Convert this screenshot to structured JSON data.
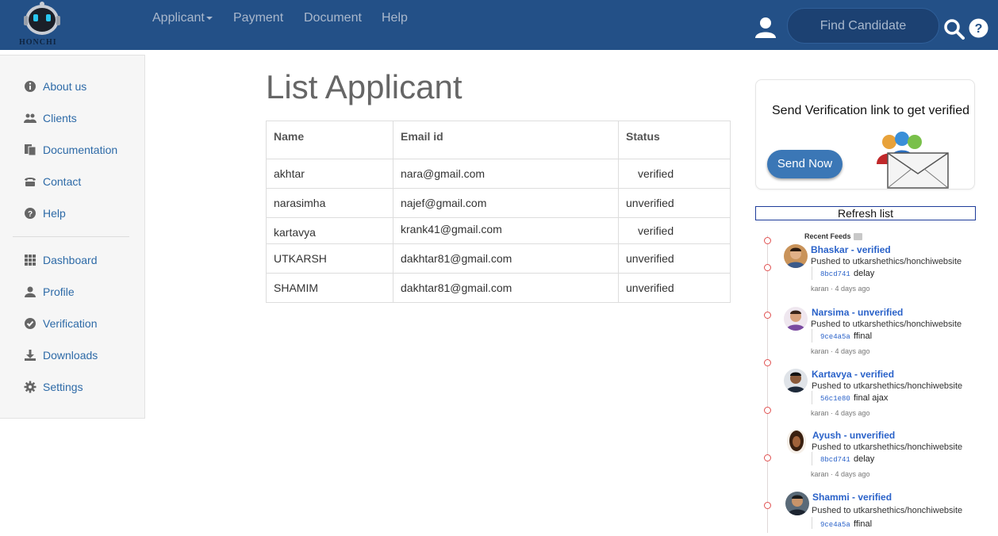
{
  "navbar": {
    "logo_text": "HONCHI",
    "menu": [
      {
        "label": "Applicant",
        "has_dropdown": true
      },
      {
        "label": "Payment"
      },
      {
        "label": "Document"
      },
      {
        "label": "Help"
      }
    ],
    "search_label": "Find Candidate",
    "colors": {
      "background": "#235087",
      "search_bg": "#1c4172"
    }
  },
  "sidebar": {
    "items": [
      {
        "label": "About us",
        "icon": "info-circle-icon"
      },
      {
        "label": "Clients",
        "icon": "users-icon"
      },
      {
        "label": "Documentation",
        "icon": "files-icon"
      },
      {
        "label": "Contact",
        "icon": "phone-icon"
      },
      {
        "label": "Help",
        "icon": "question-circle-icon"
      },
      {
        "label": "Dashboard",
        "icon": "grid-icon"
      },
      {
        "label": "Profile",
        "icon": "user-icon"
      },
      {
        "label": "Verification",
        "icon": "check-circle-icon"
      },
      {
        "label": "Downloads",
        "icon": "download-icon"
      },
      {
        "label": "Settings",
        "icon": "gear-icon"
      }
    ]
  },
  "main": {
    "title": "List Applicant",
    "table": {
      "headers": [
        "Name",
        "Email id",
        "Status"
      ],
      "rows": [
        [
          "akhtar",
          "nara@gmail.com",
          "verified"
        ],
        [
          "narasimha",
          "najef@gmail.com",
          "unverified"
        ],
        [
          "kartavya",
          "krank41@gmail.com",
          "verified"
        ],
        [
          "UTKARSH",
          "dakhtar81@gmail.com",
          "unverified"
        ],
        [
          "SHAMIM",
          "dakhtar81@gmail.com",
          "unverified"
        ]
      ]
    }
  },
  "verify_card": {
    "text": "Send Verification link to get verified",
    "button_label": "Send Now"
  },
  "refresh_label": "Refresh list",
  "feeds": {
    "title": "Recent Feeds",
    "items": [
      {
        "name": "Bhaskar - verified",
        "pushed": "Pushed to utkarshethics/honchiwebsite",
        "hash": "8bcd741",
        "message": "delay",
        "meta": "karan · 4 days ago"
      },
      {
        "name": "Narsima - unverified",
        "pushed": "Pushed to utkarshethics/honchiwebsite",
        "hash": "9ce4a5a",
        "message": "ffinal",
        "meta": "karan · 4 days ago"
      },
      {
        "name": "Kartavya - verified",
        "pushed": "Pushed to utkarshethics/honchiwebsite",
        "hash": "56c1e80",
        "message": "final ajax",
        "meta": "karan · 4 days ago"
      },
      {
        "name": "Ayush - unverified",
        "pushed": "Pushed to utkarshethics/honchiwebsite",
        "hash": "8bcd741",
        "message": "delay",
        "meta": "karan · 4 days ago"
      },
      {
        "name": "Shammi - verified",
        "pushed": "Pushed to utkarshethics/honchiwebsite",
        "hash": "9ce4a5a",
        "message": "ffinal",
        "meta": ""
      }
    ]
  }
}
